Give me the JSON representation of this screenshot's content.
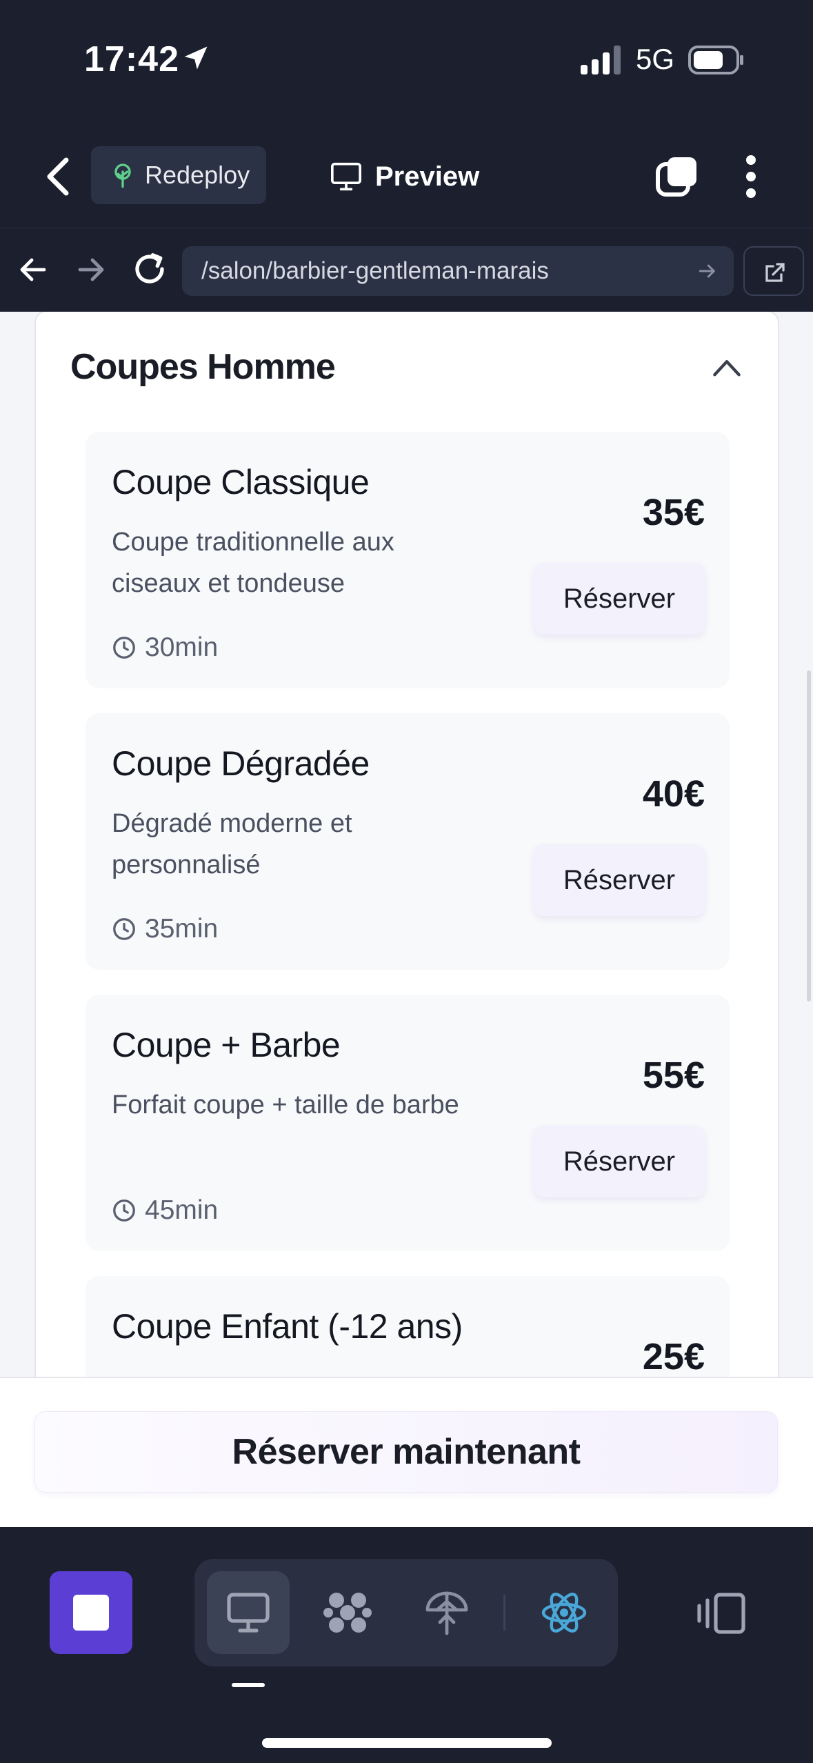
{
  "status_bar": {
    "time": "17:42",
    "network": "5G"
  },
  "toolbar": {
    "redeploy_label": "Redeploy",
    "preview_label": "Preview"
  },
  "url_bar": {
    "url": "/salon/barbier-gentleman-marais"
  },
  "section": {
    "title": "Coupes Homme",
    "services": [
      {
        "name": "Coupe Classique",
        "description": "Coupe traditionnelle aux ciseaux et tondeuse",
        "duration": "30min",
        "price": "35€",
        "button": "Réserver"
      },
      {
        "name": "Coupe Dégradée",
        "description": "Dégradé moderne et personnalisé",
        "duration": "35min",
        "price": "40€",
        "button": "Réserver"
      },
      {
        "name": "Coupe + Barbe",
        "description": "Forfait coupe + taille de barbe",
        "duration": "45min",
        "price": "55€",
        "button": "Réserver"
      },
      {
        "name": "Coupe Enfant (-12 ans)",
        "price": "25€"
      }
    ]
  },
  "cta": {
    "label": "Réserver maintenant"
  },
  "colors": {
    "accent": "#5b3fd4",
    "dark_bg": "#1b1f2e",
    "react_blue": "#4aa8d8"
  }
}
